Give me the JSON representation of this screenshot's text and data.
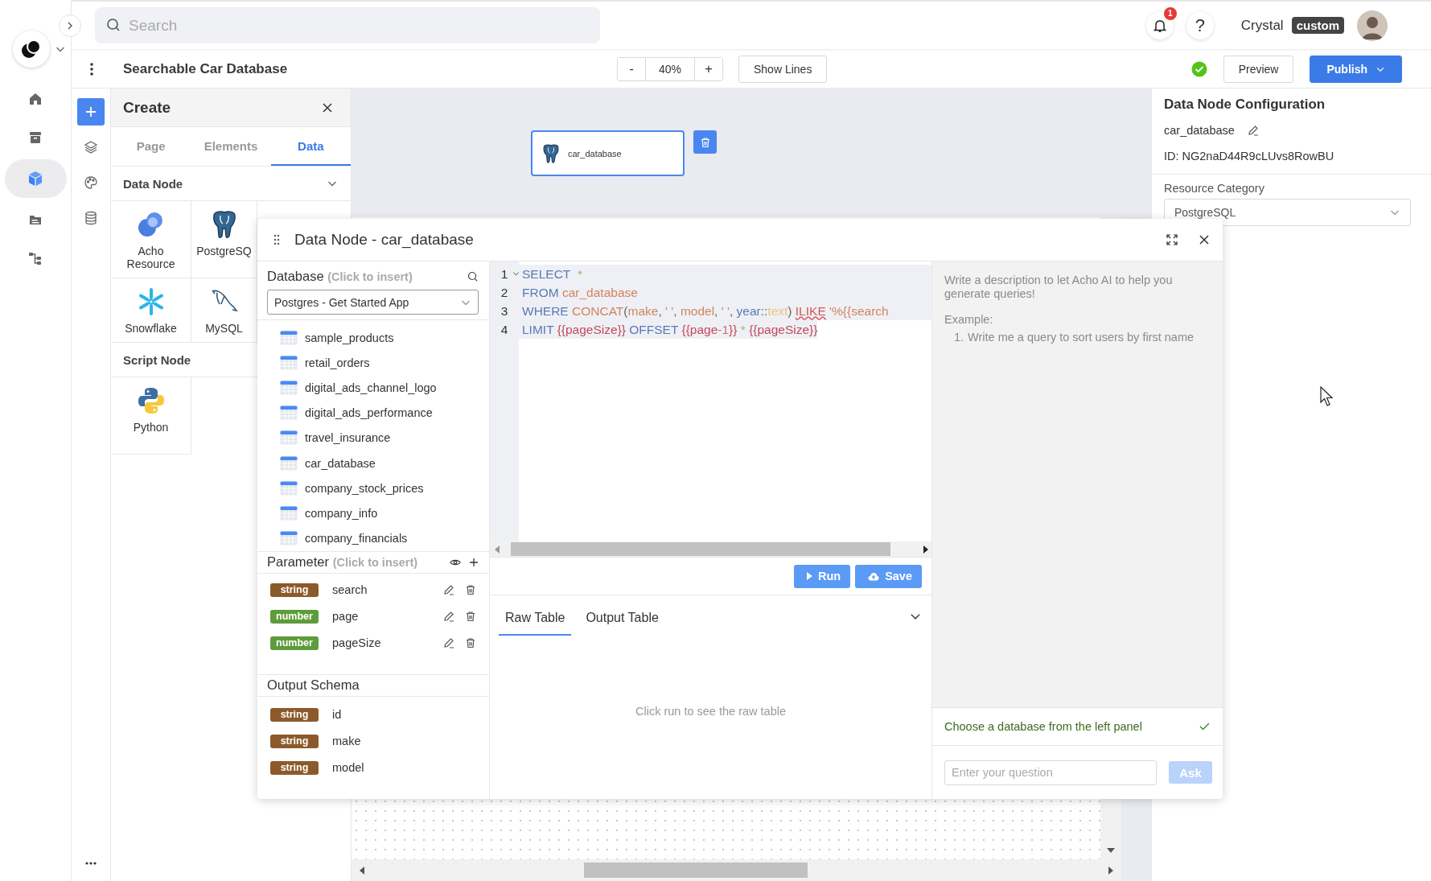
{
  "top_bar": {
    "search": {
      "placeholder": "Search"
    },
    "notification_count": "1",
    "help": "?",
    "user": {
      "name": "Crystal",
      "role": "custom"
    }
  },
  "toolbar": {
    "title": "Searchable Car Database",
    "zoom": {
      "minus": "-",
      "value": "40%",
      "plus": "+"
    },
    "show_lines": "Show Lines",
    "preview": "Preview",
    "publish": "Publish"
  },
  "nav_rail": {
    "items": [
      {
        "kind": "home",
        "selected": false
      },
      {
        "kind": "archive",
        "selected": false
      },
      {
        "kind": "cube",
        "selected": true
      },
      {
        "kind": "folder",
        "selected": false
      },
      {
        "kind": "tree",
        "selected": false
      }
    ]
  },
  "tool_rail": {
    "items": [
      {
        "kind": "plus",
        "selected": true
      },
      {
        "kind": "layers",
        "selected": false
      },
      {
        "kind": "palette",
        "selected": false
      },
      {
        "kind": "database",
        "selected": false
      }
    ]
  },
  "create_panel": {
    "title": "Create",
    "tabs": [
      {
        "label": "Page",
        "selected": false
      },
      {
        "label": "Elements",
        "selected": false
      },
      {
        "label": "Data",
        "selected": true
      }
    ],
    "sections": [
      {
        "title": "Data Node",
        "items": [
          {
            "kind": "acho",
            "label": "Acho Resource"
          },
          {
            "kind": "postgres",
            "label": "PostgreSQ"
          },
          {
            "kind": "snowflake",
            "label": "Snowflake"
          },
          {
            "kind": "mysql",
            "label": "MySQL"
          }
        ]
      },
      {
        "title": "Script Node",
        "items": [
          {
            "kind": "python",
            "label": "Python"
          }
        ]
      }
    ]
  },
  "canvas": {
    "node": {
      "label": "car_database"
    }
  },
  "config_panel": {
    "title": "Data Node Configuration",
    "name": "car_database",
    "id": "ID: NG2naD44R9cLUvs8RowBU",
    "resource_category": {
      "label": "Resource Category",
      "value": "PostgreSQL"
    }
  },
  "modal": {
    "title": "Data Node - car_database",
    "database": {
      "title": "Database",
      "hint": "(Click to insert)",
      "source": "Postgres - Get Started App",
      "tables": [
        "sample_products",
        "retail_orders",
        "digital_ads_channel_logo",
        "digital_ads_performance",
        "travel_insurance",
        "car_database",
        "company_stock_prices",
        "company_info",
        "company_financials"
      ]
    },
    "parameters": {
      "title": "Parameter",
      "hint": "(Click to insert)",
      "items": [
        {
          "type": "string",
          "name": "search"
        },
        {
          "type": "number",
          "name": "page"
        },
        {
          "type": "number",
          "name": "pageSize"
        }
      ]
    },
    "output_schema": {
      "title": "Output Schema",
      "fields": [
        {
          "type": "string",
          "name": "id"
        },
        {
          "type": "string",
          "name": "make"
        },
        {
          "type": "string",
          "name": "model"
        }
      ]
    },
    "editor": {
      "lines": [
        {
          "number": "1",
          "tokens": [
            {
              "kind": "keyword",
              "text": "SELECT"
            },
            {
              "kind": "op",
              "text": "  *"
            }
          ]
        },
        {
          "number": "2",
          "tokens": [
            {
              "kind": "keyword",
              "text": "FROM"
            },
            {
              "kind": "ident",
              "text": " car_database"
            }
          ]
        },
        {
          "number": "3",
          "tokens": [
            {
              "kind": "keyword",
              "text": "WHERE"
            },
            {
              "kind": "ident",
              "text": " CONCAT"
            },
            {
              "kind": "punct",
              "text": "("
            },
            {
              "kind": "ident",
              "text": "make"
            },
            {
              "kind": "punct",
              "text": ", "
            },
            {
              "kind": "ident",
              "text": "' '"
            },
            {
              "kind": "punct",
              "text": ", "
            },
            {
              "kind": "ident",
              "text": "model"
            },
            {
              "kind": "punct",
              "text": ", "
            },
            {
              "kind": "ident",
              "text": "' '"
            },
            {
              "kind": "punct",
              "text": ", "
            },
            {
              "kind": "keyword",
              "text": "year"
            },
            {
              "kind": "punct",
              "text": "::"
            },
            {
              "kind": "type",
              "text": "text"
            },
            {
              "kind": "punct",
              "text": ") "
            },
            {
              "kind": "error",
              "text": "ILIKE"
            },
            {
              "kind": "ident",
              "text": " '%{{search"
            }
          ]
        },
        {
          "number": "4",
          "tokens": [
            {
              "kind": "keyword",
              "text": "LIMIT "
            },
            {
              "kind": "template",
              "text": "{{pageSize}}"
            },
            {
              "kind": "keyword",
              "text": " OFFSET "
            },
            {
              "kind": "template",
              "text": "{{page"
            },
            {
              "kind": "number",
              "text": "-1"
            },
            {
              "kind": "template",
              "text": "}}"
            },
            {
              "kind": "op",
              "text": " * "
            },
            {
              "kind": "template",
              "text": "{{pageSize}}"
            }
          ]
        }
      ]
    },
    "actions": {
      "run": "Run",
      "save": "Save"
    },
    "result_tabs": [
      {
        "label": "Raw Table",
        "selected": true
      },
      {
        "label": "Output Table",
        "selected": false
      }
    ],
    "empty_message": "Click run to see the raw table",
    "assistant": {
      "intro": "Write a description to let Acho AI to help you generate queries!",
      "example_label": "Example:",
      "examples": [
        {
          "number": "1.",
          "text": "Write me a query to sort users by first name"
        }
      ],
      "status": {
        "text": "Choose a database from the left panel",
        "checked": true
      },
      "question_placeholder": "Enter your question",
      "ask": {
        "label": "Ask",
        "disabled": true
      }
    }
  }
}
